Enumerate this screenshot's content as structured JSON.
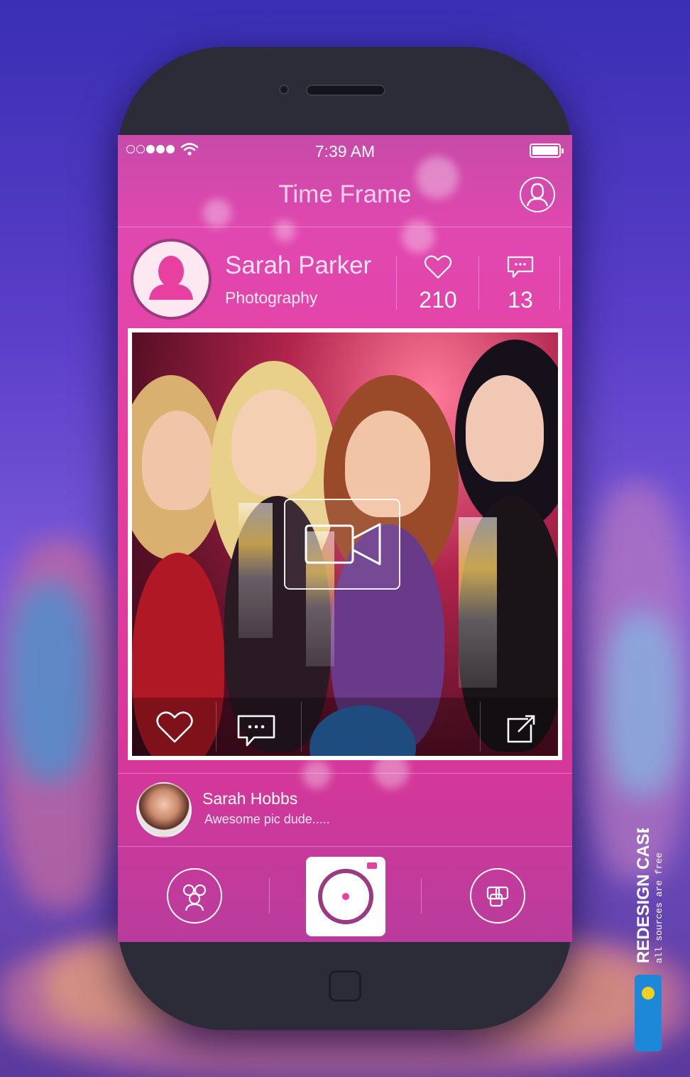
{
  "status_bar": {
    "time": "7:39 AM"
  },
  "nav": {
    "title": "Time Frame"
  },
  "profile": {
    "name": "Sarah Parker",
    "category": "Photography",
    "likes": "210",
    "comments": "13"
  },
  "comment": {
    "author": "Sarah Hobbs",
    "text": "Awesome pic dude....."
  },
  "brand": {
    "title": "REDESIGN CASE",
    "subtitle": "all sources are free"
  },
  "icons": {
    "profile": "user-circle-icon",
    "likes": "heart-icon",
    "comments": "speech-bubble-icon",
    "video": "video-camera-icon",
    "share": "share-icon",
    "friends": "group-icon",
    "camera": "camera-icon",
    "gallery": "layers-icon"
  },
  "colors": {
    "accent": "#e8409e",
    "accent_dark": "#b83c9c",
    "phone_body": "#2b2c38"
  }
}
